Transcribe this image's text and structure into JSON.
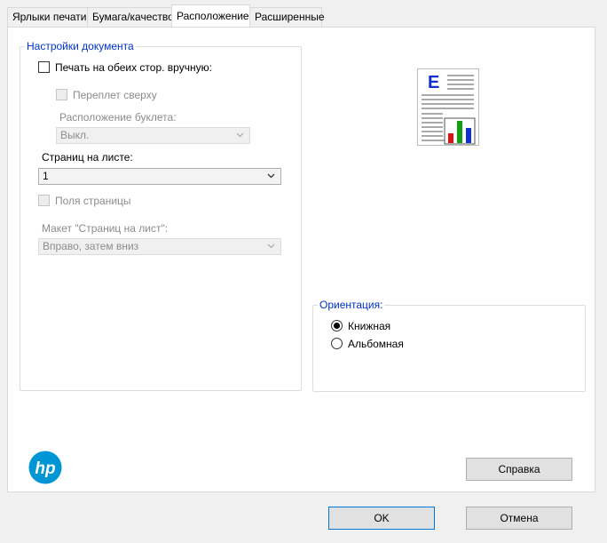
{
  "tabs": [
    {
      "label": "Ярлыки печати",
      "active": false
    },
    {
      "label": "Бумага/качество",
      "active": false
    },
    {
      "label": "Расположение",
      "active": true
    },
    {
      "label": "Расширенные",
      "active": false
    }
  ],
  "document_settings": {
    "legend": "Настройки документа",
    "duplex_manual": {
      "label": "Печать на обеих стор. вручную:",
      "checked": false
    },
    "flip_top": {
      "label": "Переплет сверху",
      "checked": false,
      "disabled": true
    },
    "booklet_label": "Расположение буклета:",
    "booklet_value": "Выкл.",
    "pages_per_sheet_label": "Страниц на листе:",
    "pages_per_sheet_value": "1",
    "page_borders": {
      "label": "Поля страницы",
      "checked": false,
      "disabled": true
    },
    "page_order_label": "Макет \"Страниц на лист\":",
    "page_order_value": "Вправо, затем вниз"
  },
  "preview": {
    "letter": "E"
  },
  "orientation": {
    "legend": "Ориентация:",
    "options": [
      {
        "label": "Книжная",
        "checked": true
      },
      {
        "label": "Альбомная",
        "checked": false
      }
    ]
  },
  "brand": {
    "logo": "hp",
    "color": "#0096d6"
  },
  "buttons": {
    "help": "Справка",
    "ok": "OK",
    "cancel": "Отмена"
  }
}
